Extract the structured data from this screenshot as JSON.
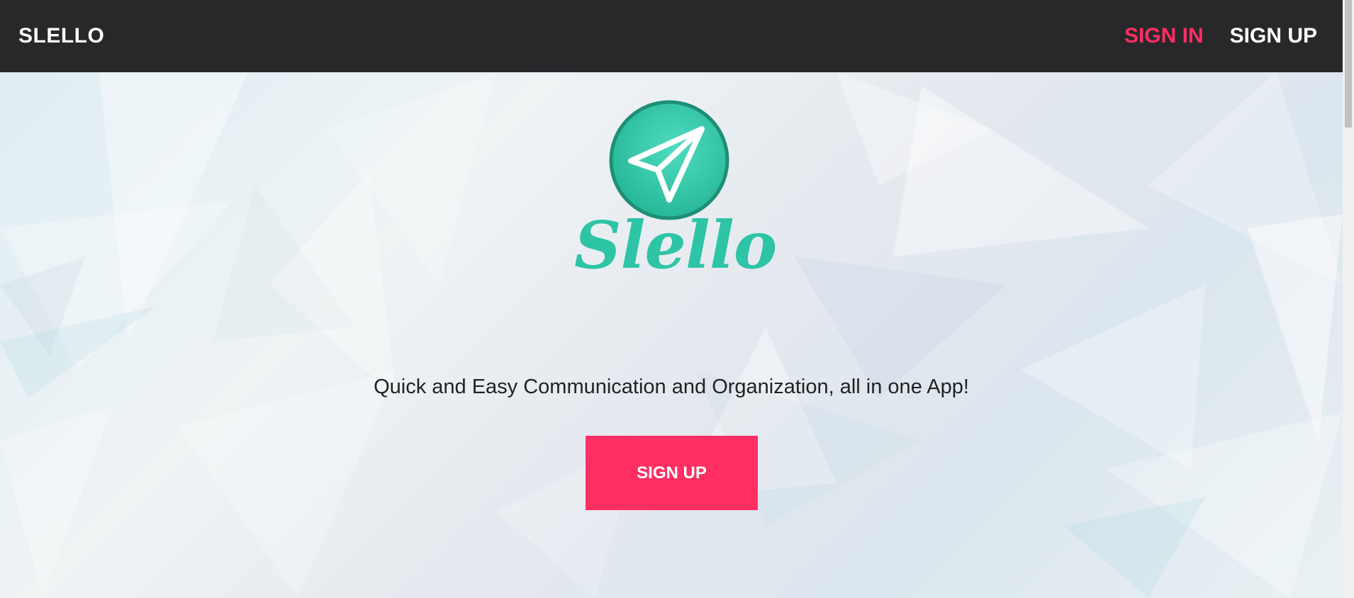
{
  "navbar": {
    "brand": "SLELLO",
    "links": [
      {
        "label": "SIGN IN"
      },
      {
        "label": "SIGN UP"
      }
    ]
  },
  "hero": {
    "logo_text": "Slello",
    "tagline": "Quick and Easy Communication and Organization, all in one App!",
    "cta_label": "SIGN UP"
  },
  "colors": {
    "navbar_bg": "#28282b",
    "accent": "#ff2e63",
    "logo_teal": "#2ec4a6"
  },
  "icons": {
    "logo_icon": "paper-plane-icon"
  }
}
